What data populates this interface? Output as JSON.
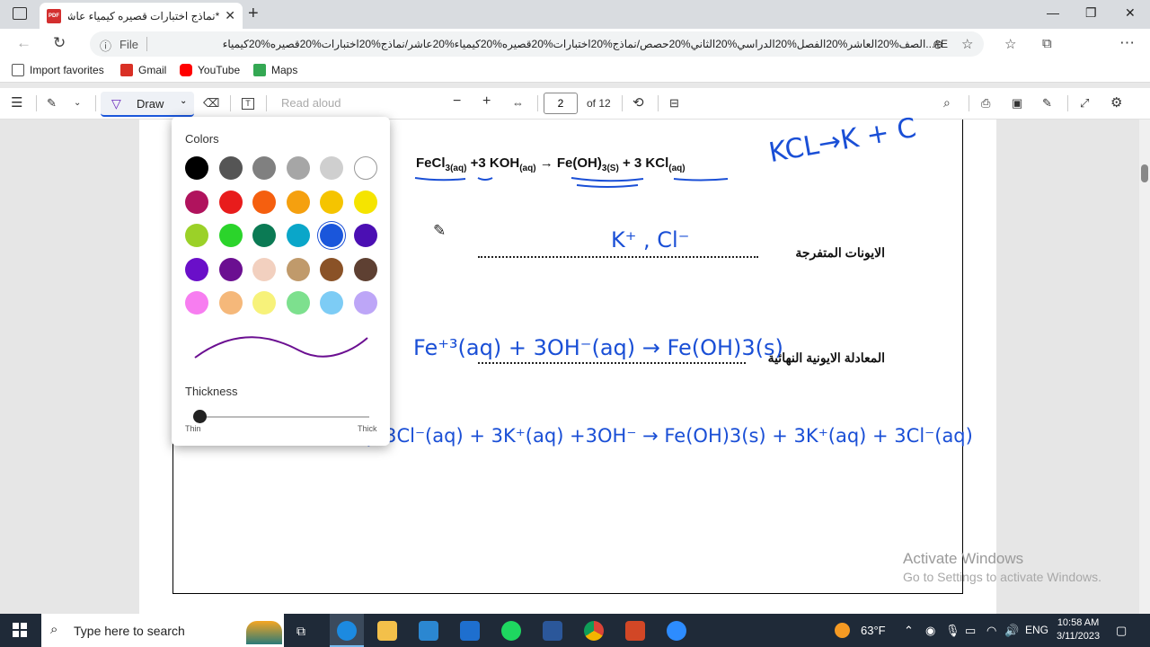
{
  "tab": {
    "title": "*نماذج اختبارات قصيره كيمياء عاشر",
    "icon": "pdf-icon"
  },
  "address": {
    "info": "ⓘ",
    "scheme": "File",
    "url": "E:/...الصف%20العاشر%20الفصل%20الدراسي%20الثاني%20حصص/نماذج%20اختبارات%20قصيره%20كيمياء%20عاشر/نماذج%20اختبارات%20قصيره%20كيمياء"
  },
  "favorites": [
    {
      "label": "Import favorites",
      "color": "#555555"
    },
    {
      "label": "Gmail",
      "color": "#d93025"
    },
    {
      "label": "YouTube",
      "color": "#ff0000"
    },
    {
      "label": "Maps",
      "color": "#34a853"
    }
  ],
  "toolbar": {
    "draw": "Draw",
    "read_aloud": "Read aloud",
    "page": "2",
    "of": "of 12"
  },
  "popup": {
    "colors_title": "Colors",
    "thickness_title": "Thickness",
    "thin": "Thin",
    "thick": "Thick",
    "selected_color": "#1a56db",
    "thickness_value": 0.0,
    "swatches": [
      "#000000",
      "#555555",
      "#808080",
      "#a6a6a6",
      "#cfcfcf",
      "#ffffff",
      "#b0135d",
      "#e81c1c",
      "#f55f0f",
      "#f5a00f",
      "#f5c400",
      "#f5e400",
      "#9bd128",
      "#2bd42b",
      "#0b7a54",
      "#0aa6c9",
      "#1a56db",
      "#4b0fb3",
      "#6a0fc9",
      "#6b0f91",
      "#f2d0bf",
      "#c09a6b",
      "#8a5227",
      "#5e4032",
      "#f77df0",
      "#f5b87a",
      "#f7f27a",
      "#7de08e",
      "#7dccf5",
      "#bda6f7"
    ]
  },
  "document": {
    "eq1_parts": [
      "FeCl",
      "3(aq)",
      " +3 KOH",
      "(aq)",
      "  →  Fe(OH)",
      "3(S)",
      "  + 3 KCl",
      "(aq)"
    ],
    "label_spectator": "الايونات المتفرجة",
    "label_net": "المعادلة الايونية النهائية",
    "hw_kcl": "KCL→K + C",
    "hw_ions": "K⁺ , Cl⁻",
    "hw_net_eq": "Fe⁺³(aq) + 3OH⁻(aq) → Fe(OH)3(s)",
    "hw_full_eq": "Fe(aq) 3Cl⁻(aq) + 3K⁺(aq) +3OH⁻ → Fe(OH)3(s) + 3K⁺(aq) + 3Cl⁻(aq)"
  },
  "activate": {
    "line1": "Activate Windows",
    "line2": "Go to Settings to activate Windows."
  },
  "taskbar": {
    "search_placeholder": "Type here to search",
    "weather": "63°F",
    "lang": "ENG",
    "time": "10:58 AM",
    "date": "3/11/2023"
  }
}
